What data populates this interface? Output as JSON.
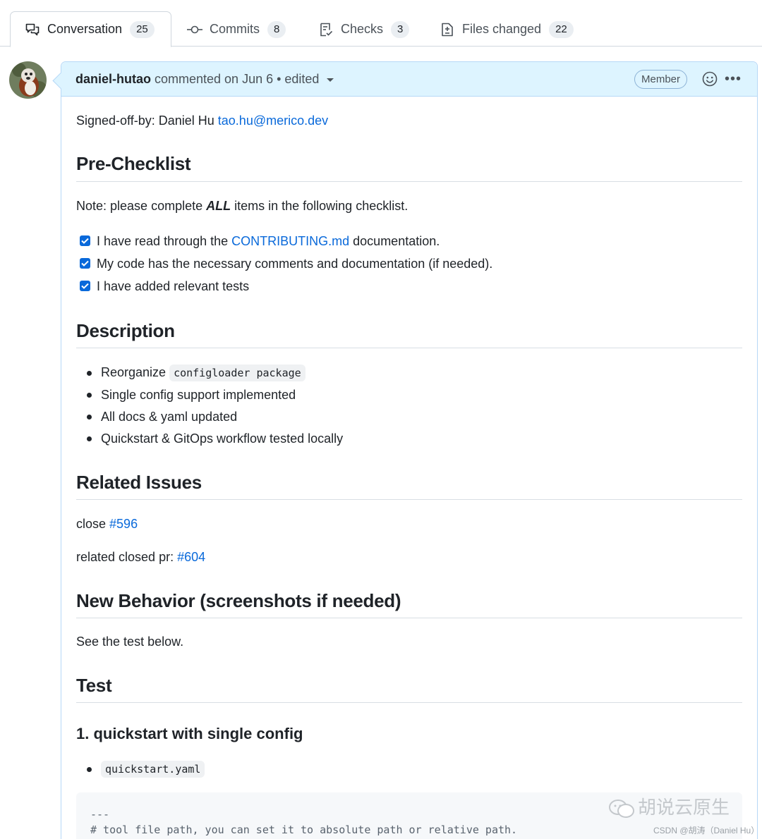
{
  "tabs": [
    {
      "label": "Conversation",
      "count": "25",
      "icon": "comment-discussion-icon"
    },
    {
      "label": "Commits",
      "count": "8",
      "icon": "git-commit-icon"
    },
    {
      "label": "Checks",
      "count": "3",
      "icon": "checklist-icon"
    },
    {
      "label": "Files changed",
      "count": "22",
      "icon": "file-diff-icon"
    }
  ],
  "comment": {
    "author": "daniel-hutao",
    "meta": "commented on Jun 6 • edited",
    "badge": "Member",
    "signed_off_prefix": "Signed-off-by: Daniel Hu ",
    "signed_off_email": "tao.hu@merico.dev"
  },
  "pre_checklist": {
    "heading": "Pre-Checklist",
    "note_prefix": "Note: please complete ",
    "note_emphasis": "ALL",
    "note_suffix": " items in the following checklist.",
    "items": [
      {
        "prefix": "I have read through the ",
        "link": "CONTRIBUTING.md",
        "suffix": " documentation.",
        "checked": true
      },
      {
        "text": "My code has the necessary comments and documentation (if needed).",
        "checked": true
      },
      {
        "text": "I have added relevant tests",
        "checked": true
      }
    ]
  },
  "description": {
    "heading": "Description",
    "item1_prefix": "Reorganize ",
    "item1_code": "configloader package",
    "item2": "Single config support implemented",
    "item3": "All docs & yaml updated",
    "item4": "Quickstart & GitOps workflow tested locally"
  },
  "related": {
    "heading": "Related Issues",
    "close_prefix": "close ",
    "close_link": "#596",
    "pr_prefix": "related closed pr: ",
    "pr_link": "#604"
  },
  "new_behavior": {
    "heading": "New Behavior (screenshots if needed)",
    "text": "See the test below."
  },
  "test": {
    "heading": "Test",
    "subheading": "1. quickstart with single config",
    "file": "quickstart.yaml",
    "code_line1": "---",
    "code_line2": "# tool file path, you can set it to absolute path or relative path."
  },
  "watermark": {
    "main": "胡说云原生",
    "sub": "CSDN @胡涛（Daniel Hu）"
  },
  "colors": {
    "link": "#0969da",
    "header_bg": "#ddf4ff",
    "header_border": "#b6d8f7",
    "check": "#0969da"
  }
}
